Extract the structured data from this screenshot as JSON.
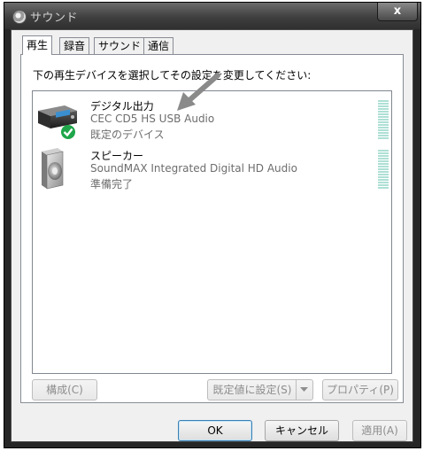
{
  "window": {
    "title": "サウンド",
    "close_label": "x"
  },
  "tabs": [
    {
      "label": "再生",
      "active": true
    },
    {
      "label": "録音",
      "active": false
    },
    {
      "label": "サウンド",
      "active": false
    },
    {
      "label": "通信",
      "active": false
    }
  ],
  "playback": {
    "instruction": "下の再生デバイスを選択してその設定を変更してください:",
    "devices": [
      {
        "name": "デジタル出力",
        "description": "CEC CD5 HS USB Audio",
        "status": "既定のデバイス",
        "icon": "digital-output-device-icon",
        "is_default": true
      },
      {
        "name": "スピーカー",
        "description": "SoundMAX Integrated Digital HD Audio",
        "status": "準備完了",
        "icon": "speaker-icon",
        "is_default": false
      }
    ],
    "buttons": {
      "configure": "構成(C)",
      "set_default": "既定値に設定(S)",
      "properties": "プロパティ(P)"
    }
  },
  "dialog_buttons": {
    "ok": "OK",
    "cancel": "キャンセル",
    "apply": "適用(A)"
  },
  "colors": {
    "level_meter": "#aee0d5",
    "default_check": "#1fa64a",
    "annotation_arrow": "#8a8a8a"
  }
}
